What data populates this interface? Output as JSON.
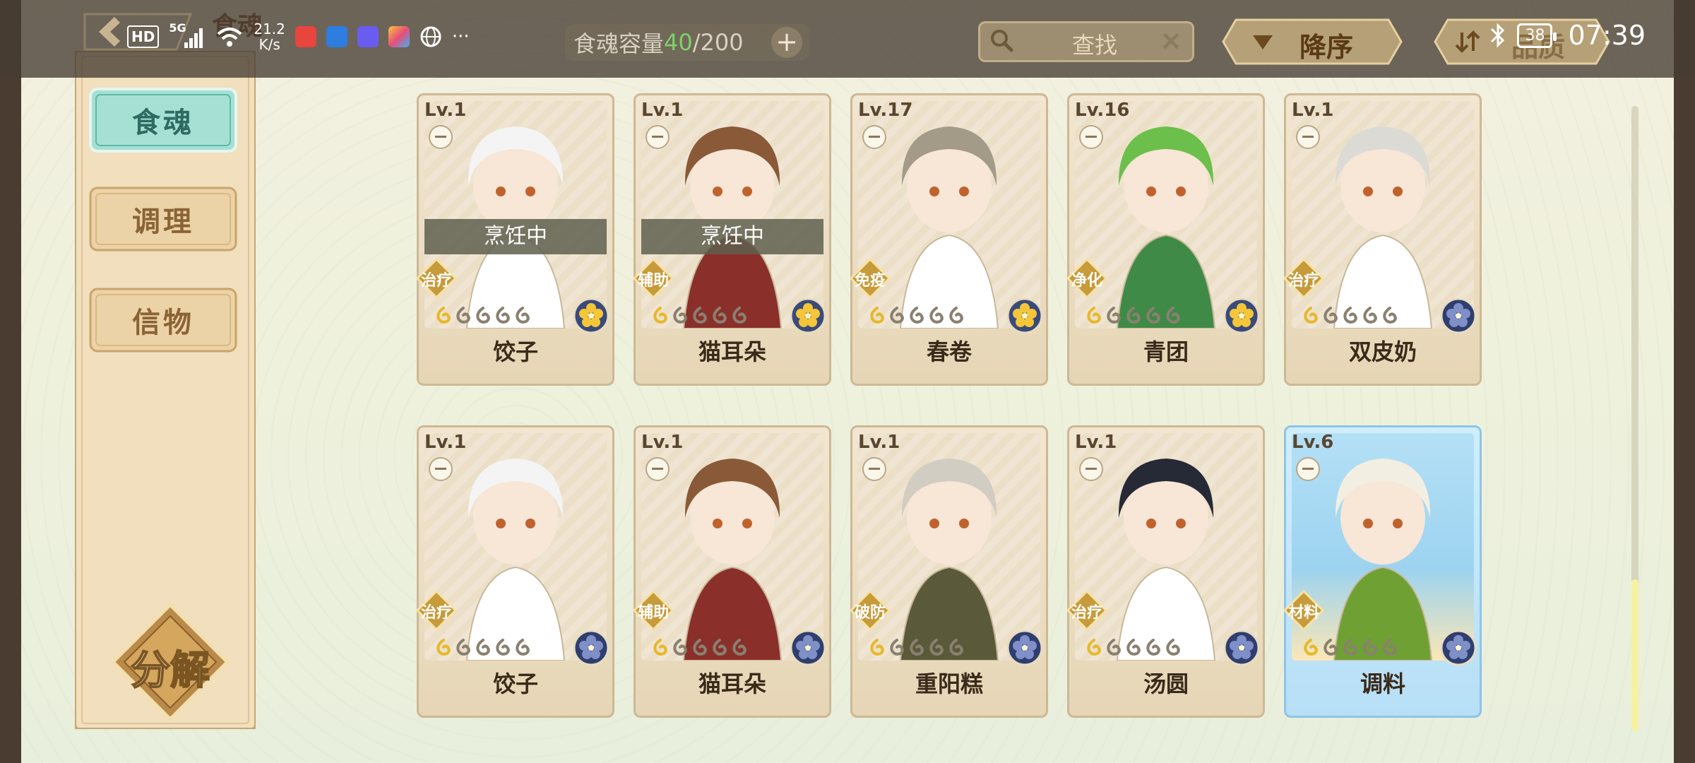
{
  "status_bar": {
    "hd": "HD",
    "signal": "5G",
    "net_speed_value": "21.2",
    "net_speed_unit": "K/s",
    "more": "···",
    "battery": "38",
    "time": "07:39"
  },
  "header": {
    "title": "食魂",
    "capacity_label": "食魂容量",
    "capacity_current": "40",
    "capacity_total": "/200",
    "capacity_add": "+",
    "search_placeholder": "查找",
    "search_clear": "×",
    "sort_label": "降序",
    "filter_label": "品质"
  },
  "sidebar": {
    "tabs": [
      {
        "label": "食魂",
        "active": true
      },
      {
        "label": "调理",
        "active": false
      },
      {
        "label": "信物",
        "active": false
      }
    ],
    "decompose_label": "分解"
  },
  "cards": [
    {
      "level": "Lv.1",
      "role": "治疗",
      "name": "饺子",
      "status": "烹饪中",
      "stars": 1,
      "element": "gold",
      "rare": false
    },
    {
      "level": "Lv.1",
      "role": "辅助",
      "name": "猫耳朵",
      "status": "烹饪中",
      "stars": 1,
      "element": "gold",
      "rare": false
    },
    {
      "level": "Lv.17",
      "role": "免疫",
      "name": "春卷",
      "status": "",
      "stars": 1,
      "element": "gold",
      "rare": false
    },
    {
      "level": "Lv.16",
      "role": "净化",
      "name": "青团",
      "status": "",
      "stars": 1,
      "element": "gold",
      "rare": false
    },
    {
      "level": "Lv.1",
      "role": "治疗",
      "name": "双皮奶",
      "status": "",
      "stars": 1,
      "element": "navy",
      "rare": false
    },
    {
      "level": "Lv.1",
      "role": "治疗",
      "name": "饺子",
      "status": "",
      "stars": 1,
      "element": "navy",
      "rare": false
    },
    {
      "level": "Lv.1",
      "role": "辅助",
      "name": "猫耳朵",
      "status": "",
      "stars": 1,
      "element": "navy",
      "rare": false
    },
    {
      "level": "Lv.1",
      "role": "破防",
      "name": "重阳糕",
      "status": "",
      "stars": 1,
      "element": "navy",
      "rare": false
    },
    {
      "level": "Lv.1",
      "role": "治疗",
      "name": "汤圆",
      "status": "",
      "stars": 1,
      "element": "navy",
      "rare": false
    },
    {
      "level": "Lv.6",
      "role": "材料",
      "name": "调料",
      "status": "",
      "stars": 1,
      "element": "navy",
      "rare": true
    }
  ],
  "colors": {
    "accent_green": "#7ed06a",
    "active_tab": "#a6e0d4",
    "card_rare": "#b7dff6",
    "scroll_thumb": "#f6f2a2"
  }
}
